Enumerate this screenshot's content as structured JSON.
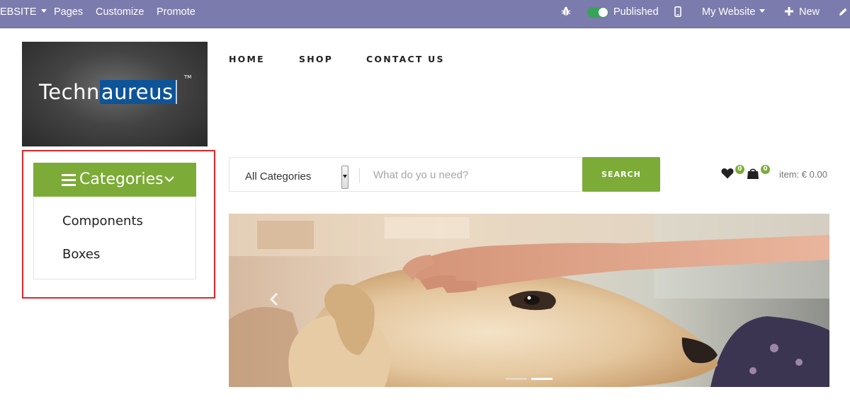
{
  "topbar": {
    "website_menu": "EBSITE",
    "pages": "Pages",
    "customize": "Customize",
    "promote": "Promote",
    "published": "Published",
    "my_website": "My Website",
    "new": "New",
    "icons": [
      "bug-icon",
      "mobile-icon",
      "plus-icon",
      "pencil-icon"
    ]
  },
  "logo": {
    "text_part1": "Techn",
    "text_part2": "aureus",
    "tm": "TM"
  },
  "nav": {
    "items": [
      "HOME",
      "SHOP",
      "CONTACT US"
    ]
  },
  "categories": {
    "title": "Categories",
    "items": [
      "Components",
      "Boxes"
    ]
  },
  "search": {
    "category_value": "All Categories",
    "placeholder": "What do yo u need?",
    "button": "SEARCH"
  },
  "cart": {
    "wishlist_count": "0",
    "cart_count": "0",
    "total": "item: € 0.00"
  },
  "colors": {
    "topbar": "#7c7bad",
    "accent_green": "#7cab37",
    "highlight_red": "#e0262b",
    "toggle_green": "#35a456"
  }
}
